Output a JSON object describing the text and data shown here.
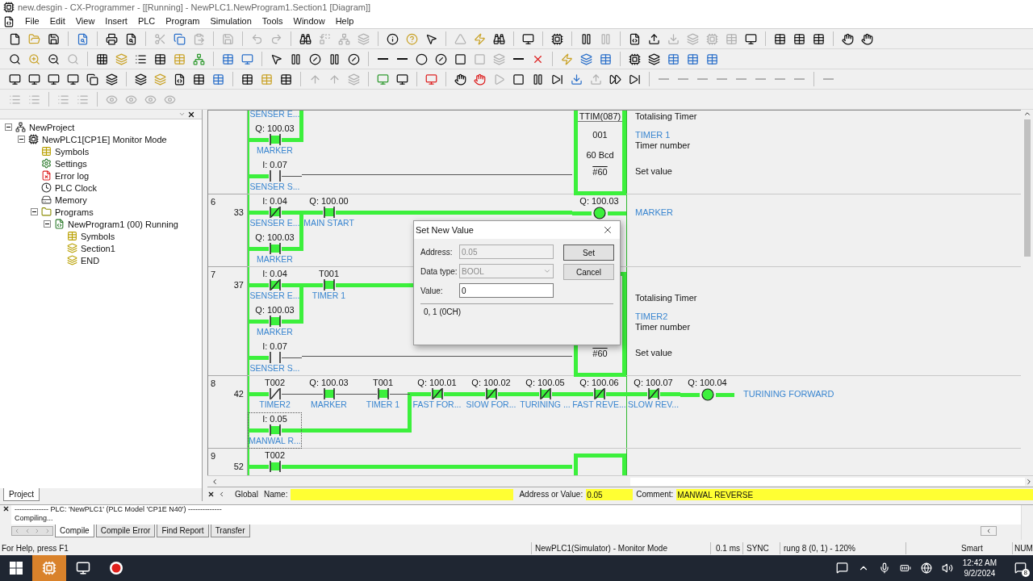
{
  "window": {
    "title": "new.desgin - CX-Programmer - [[Running] - NewPLC1.NewProgram1.Section1 [Diagram]]"
  },
  "menu": [
    "File",
    "Edit",
    "View",
    "Insert",
    "PLC",
    "Program",
    "Simulation",
    "Tools",
    "Window",
    "Help"
  ],
  "project_tree": {
    "items": [
      {
        "label": "NewProject",
        "kind": "project",
        "expanded": true,
        "children": [
          {
            "label": "NewPLC1[CP1E] Monitor Mode",
            "kind": "plc",
            "expanded": true,
            "children": [
              {
                "label": "Symbols",
                "kind": "symbols"
              },
              {
                "label": "Settings",
                "kind": "settings"
              },
              {
                "label": "Error log",
                "kind": "errorlog"
              },
              {
                "label": "PLC Clock",
                "kind": "clock"
              },
              {
                "label": "Memory",
                "kind": "memory"
              },
              {
                "label": "Programs",
                "kind": "programs",
                "expanded": true,
                "children": [
                  {
                    "label": "NewProgram1 (00) Running",
                    "kind": "program",
                    "expanded": true,
                    "children": [
                      {
                        "label": "Symbols",
                        "kind": "symbols"
                      },
                      {
                        "label": "Section1",
                        "kind": "section"
                      },
                      {
                        "label": "END",
                        "kind": "section"
                      }
                    ]
                  }
                ]
              }
            ]
          }
        ]
      }
    ]
  },
  "panel_tabs": [
    {
      "label": "Project",
      "selected": true
    }
  ],
  "diagram": {
    "rungs": [
      {
        "rows": [
          {
            "kind": "line",
            "cells": [
              {
                "kind": "no",
                "label": "SENSER E...",
                "selected": false
              }
            ]
          },
          {
            "kind": "branch",
            "cells": [
              {
                "kind": "no",
                "address": "Q: 100.03",
                "label": "MARKER",
                "energized": true,
                "selected": false
              }
            ]
          },
          {
            "kind": "line",
            "cells": [
              {
                "kind": "no",
                "address": "I: 0.07",
                "label": "SENSER S...",
                "energized": false,
                "selected": false
              }
            ]
          }
        ],
        "box": {
          "energized": true,
          "lines": [
            {
              "kind": "instruction",
              "text": "TTIM(087)"
            },
            {
              "kind": "number",
              "text": "001"
            },
            {
              "kind": "preset_text",
              "text": "60 Bcd"
            },
            {
              "kind": "preset",
              "text": "#60"
            }
          ],
          "comments": [
            {
              "kind": "title",
              "text": "Totalising Timer"
            },
            {
              "kind": "symbol",
              "text": "TIMER 1"
            },
            {
              "kind": "operand",
              "text": "Timer number"
            },
            {
              "kind": "setting",
              "text": "Set value"
            }
          ]
        }
      },
      {
        "number": "6",
        "step": "33",
        "rows": [
          {
            "kind": "line",
            "cells": [
              {
                "kind": "nc",
                "address": "I: 0.04",
                "label": "SENSER E...",
                "energized": true,
                "selected": false
              },
              {
                "kind": "no",
                "address": "Q: 100.00",
                "label": "MAIN START",
                "energized": true,
                "selected": false
              },
              {
                "kind": "wire"
              },
              {
                "kind": "wire"
              },
              {
                "kind": "wire"
              },
              {
                "kind": "wire"
              },
              {
                "kind": "coil",
                "address": "Q: 100.03",
                "comment": "MARKER",
                "energized": true,
                "selected": false
              }
            ]
          },
          {
            "kind": "branch",
            "cells": [
              {
                "kind": "no",
                "address": "Q: 100.03",
                "label": "MARKER",
                "energized": true,
                "selected": false
              }
            ]
          }
        ]
      },
      {
        "number": "7",
        "step": "37",
        "rows": [
          {
            "kind": "line",
            "cells": [
              {
                "kind": "nc",
                "address": "I: 0.04",
                "label": "SENSER E...",
                "energized": true,
                "selected": false
              },
              {
                "kind": "no",
                "address": "T001",
                "label": "TIMER 1",
                "energized": true,
                "selected": false
              }
            ]
          },
          {
            "kind": "branch",
            "cells": [
              {
                "kind": "no",
                "address": "Q: 100.03",
                "label": "MARKER",
                "energized": true,
                "selected": false
              }
            ]
          },
          {
            "kind": "line",
            "cells": [
              {
                "kind": "no",
                "address": "I: 0.07",
                "label": "SENSER S...",
                "energized": false,
                "selected": false
              }
            ]
          }
        ],
        "box": {
          "energized": true,
          "lines": [
            {
              "kind": "preset",
              "text": "#60"
            }
          ],
          "comments": [
            {
              "kind": "title",
              "text": "Totalising Timer"
            },
            {
              "kind": "symbol",
              "text": "TIMER2"
            },
            {
              "kind": "operand",
              "text": "Timer number"
            },
            {
              "kind": "setting",
              "text": "Set value"
            }
          ]
        }
      },
      {
        "number": "8",
        "step": "42",
        "rows": [
          {
            "kind": "line",
            "cells": [
              {
                "kind": "nc",
                "address": "T002",
                "label": "TIMER2",
                "energized": false,
                "selected": false
              },
              {
                "kind": "no",
                "address": "Q: 100.03",
                "label": "MARKER",
                "energized": true,
                "selected": false
              },
              {
                "kind": "no",
                "address": "T001",
                "label": "TIMER 1",
                "energized": true,
                "selected": false
              },
              {
                "kind": "nc",
                "address": "Q: 100.01",
                "label": "FAST FOR...",
                "energized": true,
                "selected": false
              },
              {
                "kind": "nc",
                "address": "Q: 100.02",
                "label": "SIOW FOR...",
                "energized": true,
                "selected": false
              },
              {
                "kind": "nc",
                "address": "Q: 100.05",
                "label": "TURINING ...",
                "energized": true,
                "selected": false
              },
              {
                "kind": "nc",
                "address": "Q: 100.06",
                "label": "FAST REVE...",
                "energized": true,
                "selected": false
              },
              {
                "kind": "nc",
                "address": "Q: 100.07",
                "label": "SLOW REV...",
                "energized": true,
                "selected": false
              },
              {
                "kind": "coil",
                "address": "Q: 100.04",
                "comment": "TURINING FORWARD",
                "energized": true,
                "selected": false
              }
            ]
          },
          {
            "kind": "branch",
            "cells": [
              {
                "kind": "no",
                "address": "I: 0.05",
                "label": "MANWAL R...",
                "energized": true,
                "selected": true
              },
              {
                "kind": "wire"
              },
              {
                "kind": "wire"
              }
            ]
          }
        ]
      },
      {
        "number": "9",
        "step": "52",
        "rows": [
          {
            "kind": "line",
            "cells": [
              {
                "kind": "no",
                "address": "T002",
                "energized": true,
                "selected": false
              }
            ]
          }
        ],
        "box": {
          "energized": true
        }
      }
    ]
  },
  "dialog": {
    "title": "Set New Value",
    "address_label": "Address:",
    "address_value": "0.05",
    "type_label": "Data type:",
    "type_value": "BOOL",
    "value_label": "Value:",
    "value": "0",
    "buttons": [
      "Set",
      "Cancel"
    ],
    "info": "0, 1 (0CH)"
  },
  "info_bar": {
    "tab": "Global",
    "name_label": "Name:",
    "address_label": "Address or Value:",
    "address_value": "0.05",
    "comment_label": "Comment:",
    "comment_value": "MANWAL REVERSE"
  },
  "output": {
    "lines": [
      "-------------- PLC: 'NewPLC1' (PLC Model 'CP1E N40') --------------",
      "Compiling..."
    ],
    "tabs": [
      {
        "label": "Compile",
        "selected": true
      },
      {
        "label": "Compile Error",
        "selected": false
      },
      {
        "label": "Find Report",
        "selected": false
      },
      {
        "label": "Transfer",
        "selected": false
      }
    ]
  },
  "status_bar": {
    "help": "For Help, press F1",
    "mode": "NewPLC1(Simulator) - Monitor Mode",
    "cycle": "0.1 ms",
    "sync": "SYNC",
    "position": "rung 8 (0, 1) - 120%",
    "mode2": "Smart",
    "num": "NUM"
  },
  "taskbar": {
    "time": "12:42 AM",
    "date": "9/2/2024",
    "notifications": "8"
  }
}
